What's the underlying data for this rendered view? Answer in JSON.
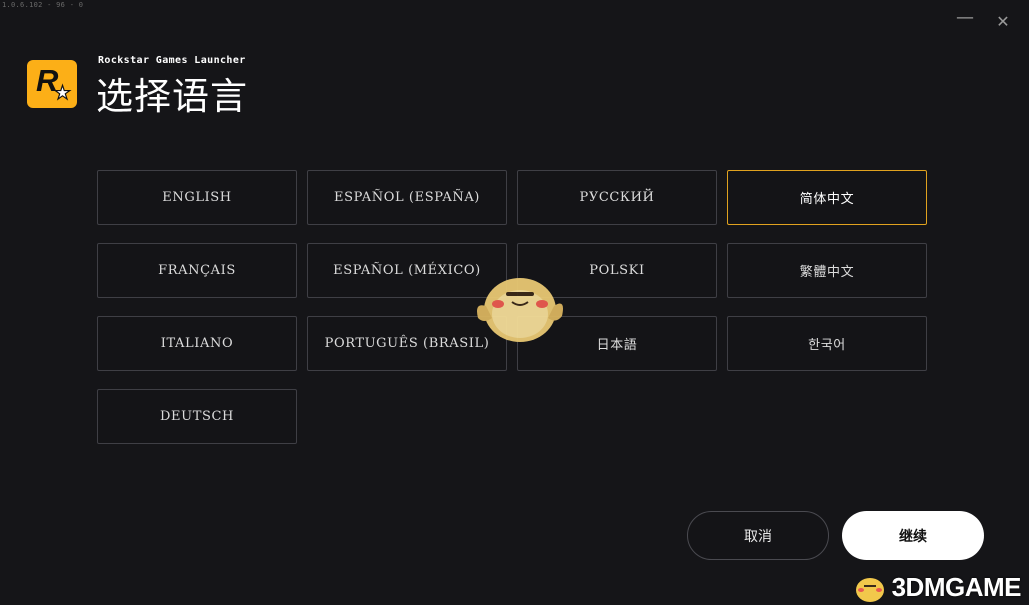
{
  "version": "1.0.6.102 - 96 - 0",
  "window": {
    "minimize_icon": "minimize-icon",
    "close_icon": "close-icon"
  },
  "brand": {
    "app_name": "Rockstar Games Launcher",
    "logo_letter": "R",
    "logo_color": "#fcaf17"
  },
  "page": {
    "title": "选择语言"
  },
  "languages": [
    {
      "label": "ENGLISH",
      "selected": false
    },
    {
      "label": "ESPAÑOL (ESPAÑA)",
      "selected": false
    },
    {
      "label": "РУССКИЙ",
      "selected": false
    },
    {
      "label": "简体中文",
      "selected": true
    },
    {
      "label": "FRANÇAIS",
      "selected": false
    },
    {
      "label": "ESPAÑOL (MÉXICO)",
      "selected": false
    },
    {
      "label": "POLSKI",
      "selected": false
    },
    {
      "label": "繁體中文",
      "selected": false
    },
    {
      "label": "ITALIANO",
      "selected": false
    },
    {
      "label": "PORTUGUÊS (BRASIL)",
      "selected": false
    },
    {
      "label": "日本語",
      "selected": false
    },
    {
      "label": "한국어",
      "selected": false
    },
    {
      "label": "DEUTSCH",
      "selected": false
    }
  ],
  "actions": {
    "cancel_label": "取消",
    "continue_label": "继续"
  },
  "colors": {
    "background": "#151518",
    "selected_border": "#e0a21f",
    "button_border": "#3f3f45"
  },
  "watermark": {
    "text": "3DMGAME"
  }
}
